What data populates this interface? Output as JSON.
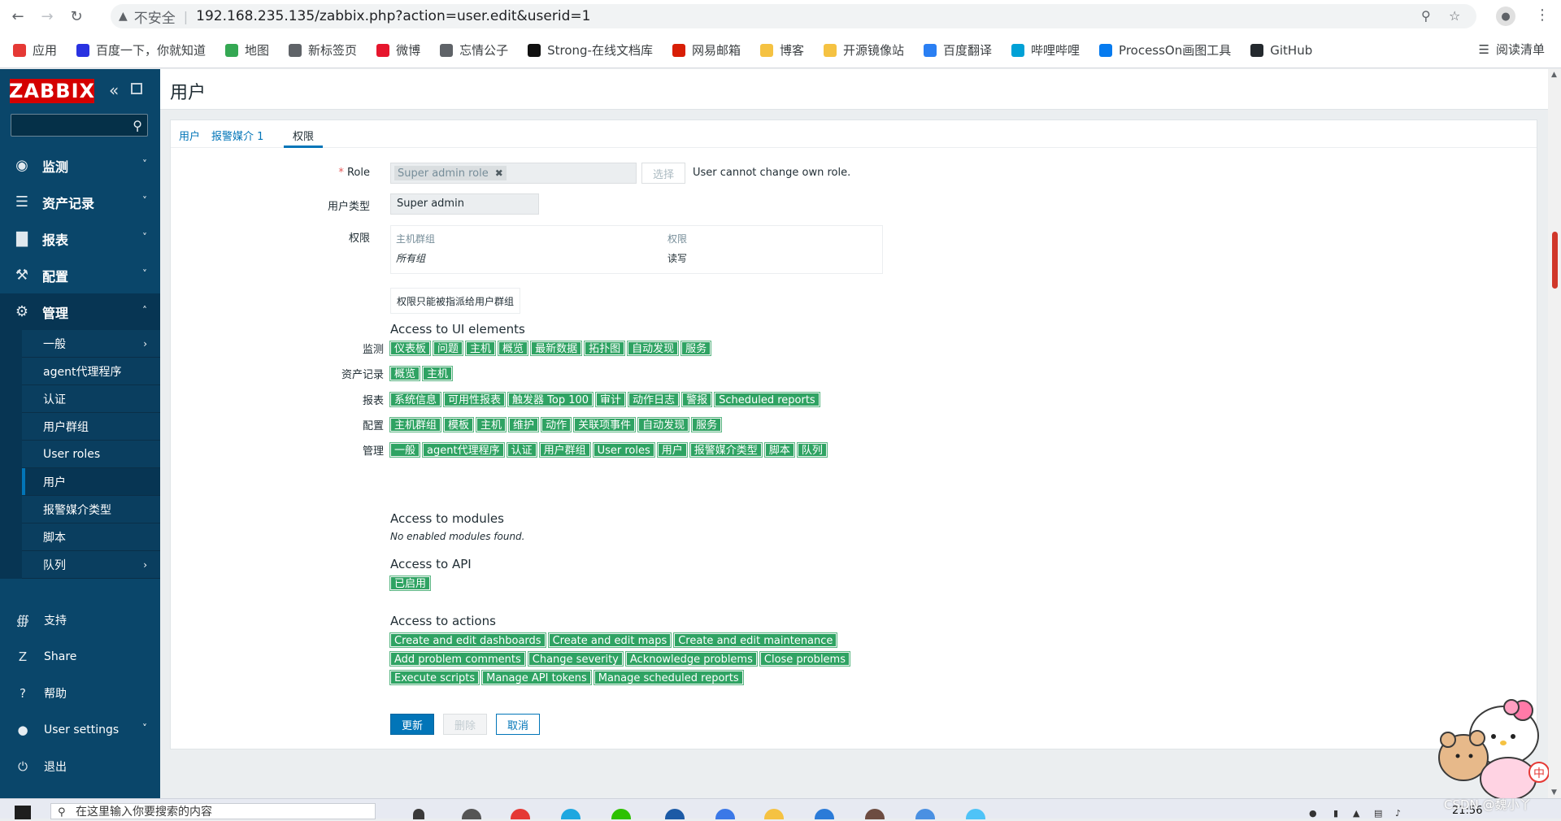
{
  "browser": {
    "insecure_label": "不安全",
    "url": "192.168.235.135/zabbix.php?action=user.edit&userid=1",
    "bookmarks": [
      {
        "label": "应用",
        "color": "#e53935"
      },
      {
        "label": "百度一下，你就知道",
        "color": "#2932e1"
      },
      {
        "label": "地图",
        "color": "#34a853"
      },
      {
        "label": "新标签页",
        "color": "#5f6368"
      },
      {
        "label": "微博",
        "color": "#e6162d"
      },
      {
        "label": "忘情公子",
        "color": "#5f6368"
      },
      {
        "label": "Strong-在线文档库",
        "color": "#111111"
      },
      {
        "label": "网易邮箱",
        "color": "#d81e06"
      },
      {
        "label": "博客",
        "color": "#f5c242"
      },
      {
        "label": "开源镜像站",
        "color": "#f5c242"
      },
      {
        "label": "百度翻译",
        "color": "#2a7ff3"
      },
      {
        "label": "哔哩哔哩",
        "color": "#00a1d6"
      },
      {
        "label": "ProcessOn画图工具",
        "color": "#067bef"
      },
      {
        "label": "GitHub",
        "color": "#24292e"
      }
    ],
    "reading_list": "阅读清单"
  },
  "sidebar": {
    "logo": "ZABBIX",
    "menu": [
      {
        "label": "监测",
        "icon": "eye-icon"
      },
      {
        "label": "资产记录",
        "icon": "list-icon"
      },
      {
        "label": "报表",
        "icon": "chart-icon"
      },
      {
        "label": "配置",
        "icon": "wrench-icon"
      },
      {
        "label": "管理",
        "icon": "gear-icon"
      }
    ],
    "submenu": [
      "一般",
      "agent代理程序",
      "认证",
      "用户群组",
      "User roles",
      "用户",
      "报警媒介类型",
      "脚本",
      "队列"
    ],
    "bottom": [
      {
        "label": "支持",
        "icon": "headset-icon"
      },
      {
        "label": "Share",
        "icon": "share-icon"
      },
      {
        "label": "帮助",
        "icon": "help-icon"
      },
      {
        "label": "User settings",
        "icon": "user-icon"
      },
      {
        "label": "退出",
        "icon": "power-icon"
      }
    ]
  },
  "page": {
    "title": "用户",
    "tabs": [
      "用户",
      "报警媒介 1",
      "权限"
    ],
    "role_label": "Role",
    "role_value": "Super admin role",
    "select_label": "选择",
    "role_note": "User cannot change own role.",
    "usertype_label": "用户类型",
    "usertype_value": "Super admin",
    "perm_label": "权限",
    "perm_table": {
      "col1": "主机群组",
      "col2": "权限",
      "row_group": "所有组",
      "row_perm": "读写"
    },
    "perm_note": "权限只能被指派给用户群组",
    "ui_title": "Access to UI elements",
    "ui_rows": [
      {
        "label": "监测",
        "tags": [
          "仪表板",
          "问题",
          "主机",
          "概览",
          "最新数据",
          "拓扑图",
          "自动发现",
          "服务"
        ]
      },
      {
        "label": "资产记录",
        "tags": [
          "概览",
          "主机"
        ]
      },
      {
        "label": "报表",
        "tags": [
          "系统信息",
          "可用性报表",
          "触发器 Top 100",
          "审计",
          "动作日志",
          "警报",
          "Scheduled reports"
        ]
      },
      {
        "label": "配置",
        "tags": [
          "主机群组",
          "模板",
          "主机",
          "维护",
          "动作",
          "关联项事件",
          "自动发现",
          "服务"
        ]
      },
      {
        "label": "管理",
        "tags": [
          "一般",
          "agent代理程序",
          "认证",
          "用户群组",
          "User roles",
          "用户",
          "报警媒介类型",
          "脚本",
          "队列"
        ]
      }
    ],
    "modules_title": "Access to modules",
    "modules_note": "No enabled modules found.",
    "api_title": "Access to API",
    "api_tag": "已启用",
    "actions_title": "Access to actions",
    "actions_rows": [
      [
        "Create and edit dashboards",
        "Create and edit maps",
        "Create and edit maintenance"
      ],
      [
        "Add problem comments",
        "Change severity",
        "Acknowledge problems",
        "Close problems"
      ],
      [
        "Execute scripts",
        "Manage API tokens",
        "Manage scheduled reports"
      ]
    ],
    "btn_update": "更新",
    "btn_delete": "删除",
    "btn_cancel": "取消"
  },
  "taskbar": {
    "search_placeholder": "在这里输入你要搜索的内容",
    "time": "21:56",
    "watermark": "CSDN @魏小丫"
  },
  "colors": {
    "sidebar": "#0a466a",
    "accent": "#0275b8",
    "tag_green": "#2fa363",
    "logo_red": "#d40000"
  }
}
